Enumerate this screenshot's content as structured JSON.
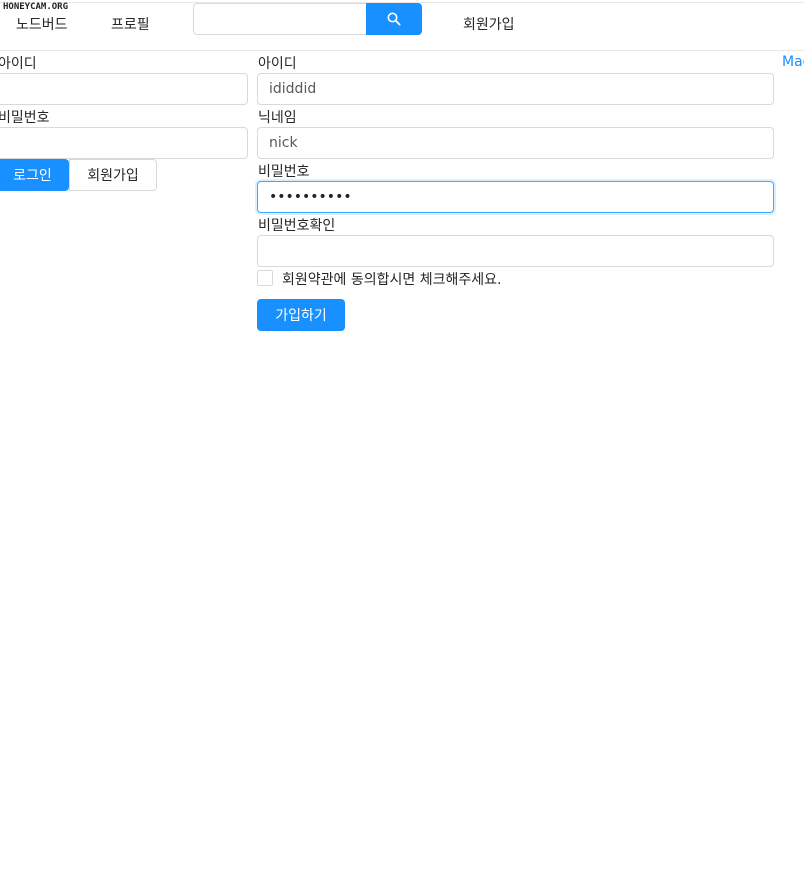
{
  "watermark": "HONEYCAM.ORG",
  "nav": {
    "board_label": "노드버드",
    "profile_label": "프로필",
    "search_value": "",
    "signup_label": "회원가입"
  },
  "login_form": {
    "id_label": "아이디",
    "id_value": "",
    "password_label": "비밀번호",
    "password_value": "",
    "login_button": "로그인",
    "signup_button": "회원가입"
  },
  "signup_form": {
    "id_label": "아이디",
    "id_value": "ididdid",
    "nickname_label": "닉네임",
    "nickname_value": "nick",
    "password_label": "비밀번호",
    "password_value": "••••••••••",
    "password_check_label": "비밀번호확인",
    "password_check_value": "",
    "terms_label": "회원약관에 동의합시면 체크해주세요.",
    "submit_button": "가입하기"
  },
  "side_link": "Mad",
  "colors": {
    "primary": "#1890ff",
    "border": "#d9d9d9",
    "focus_border": "#40a9ff"
  },
  "icons": {
    "search": "search-icon"
  }
}
